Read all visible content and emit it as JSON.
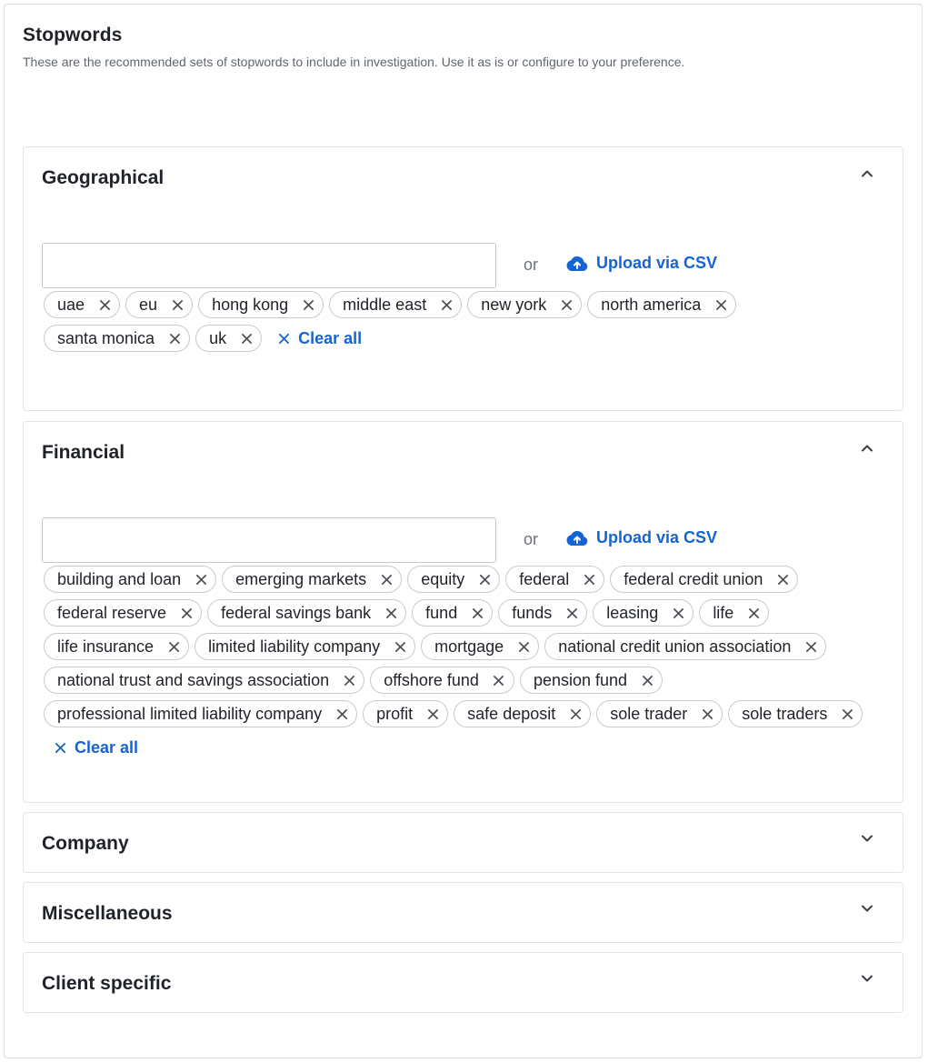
{
  "header": {
    "title": "Stopwords",
    "subtitle": "These are the recommended sets of stopwords to include in investigation. Use it as is or configure to your preference."
  },
  "common": {
    "or_label": "or",
    "upload_label": "Upload via CSV",
    "clear_all_label": "Clear all"
  },
  "sections": {
    "geographical": {
      "title": "Geographical",
      "input_value": "",
      "chips": [
        "uae",
        "eu",
        "hong kong",
        "middle east",
        "new york",
        "north america",
        "santa monica",
        "uk"
      ]
    },
    "financial": {
      "title": "Financial",
      "input_value": "",
      "chips": [
        "building and loan",
        "emerging markets",
        "equity",
        "federal",
        "federal credit union",
        "federal reserve",
        "federal savings bank",
        "fund",
        "funds",
        "leasing",
        "life",
        "life insurance",
        "limited liability company",
        "mortgage",
        "national credit union association",
        "national trust and savings association",
        "offshore fund",
        "pension fund",
        "professional limited liability company",
        "profit",
        "safe deposit",
        "sole trader",
        "sole traders"
      ]
    },
    "company": {
      "title": "Company"
    },
    "miscellaneous": {
      "title": "Miscellaneous"
    },
    "client_specific": {
      "title": "Client specific"
    }
  },
  "icons": {
    "chevron_up": "chevron-up-icon",
    "chevron_down": "chevron-down-icon",
    "upload": "cloud-upload-icon",
    "remove": "close-icon"
  },
  "colors": {
    "accent": "#1464d6",
    "text": "#1f2329",
    "border": "#e1e4e8"
  }
}
